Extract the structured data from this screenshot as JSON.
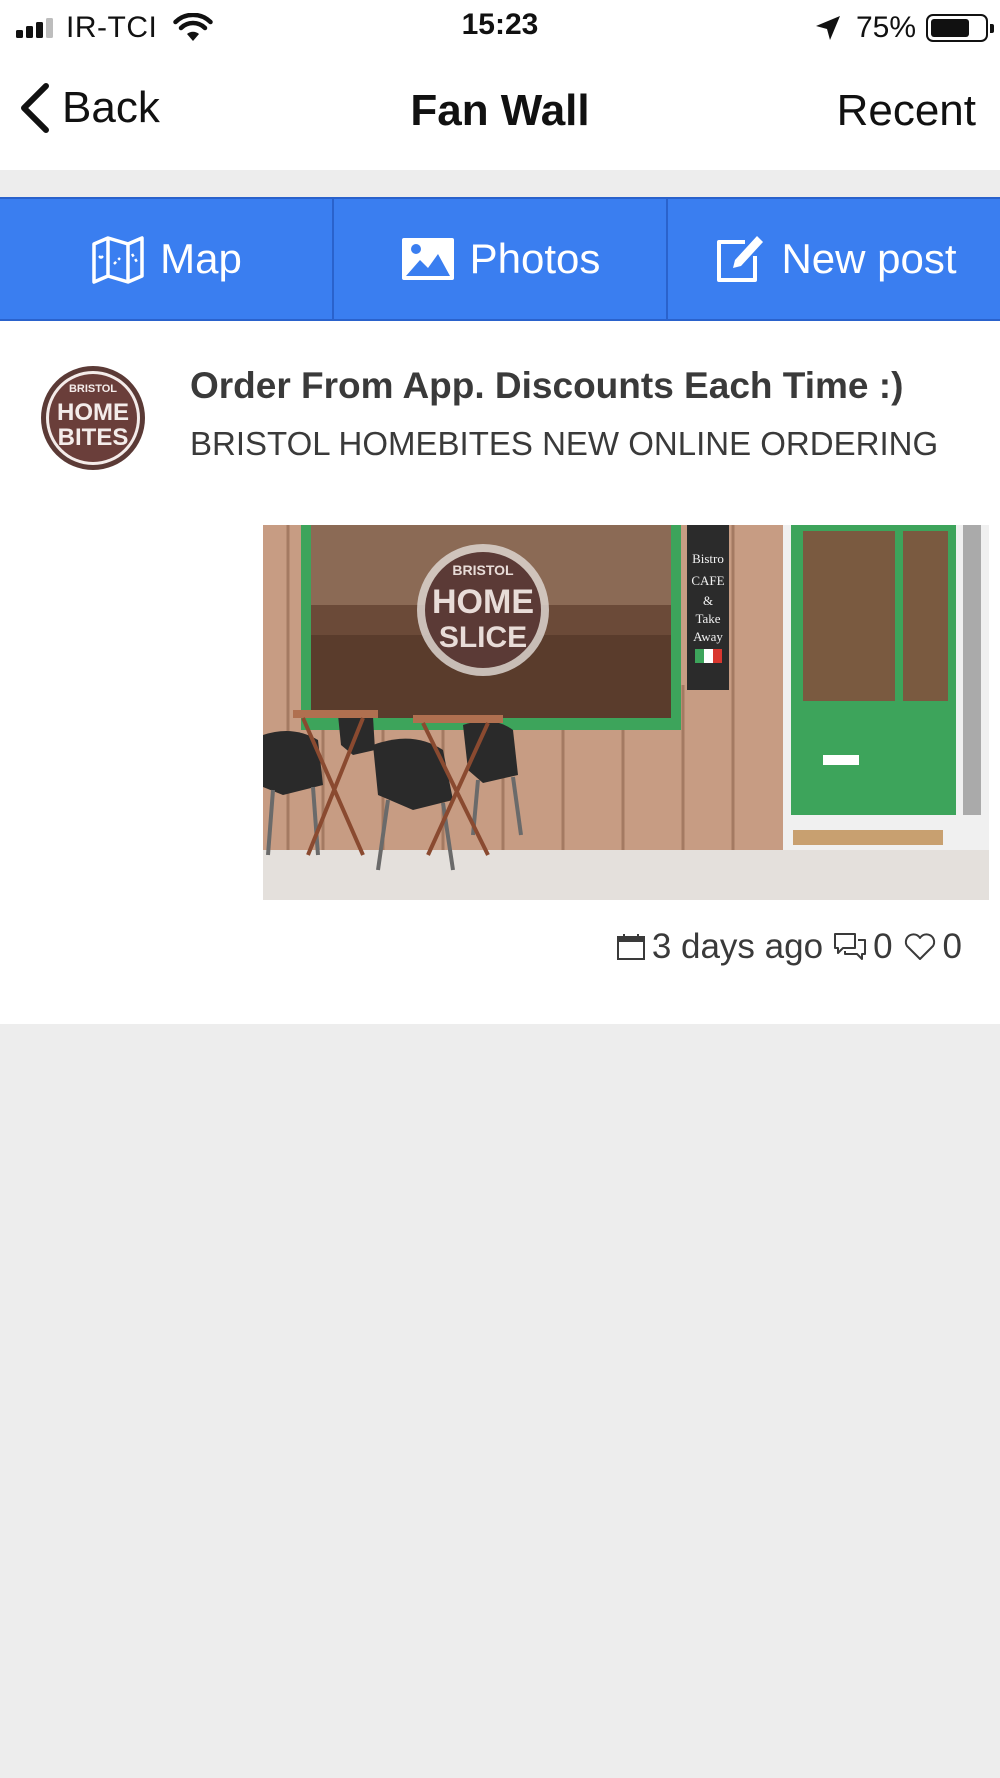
{
  "status_bar": {
    "carrier": "IR-TCI",
    "time": "15:23",
    "battery_percent_label": "75%",
    "battery_level": 0.75
  },
  "nav": {
    "back_label": "Back",
    "title": "Fan Wall",
    "right_label": "Recent"
  },
  "actions": [
    {
      "label": "Map",
      "icon": "map-icon"
    },
    {
      "label": "Photos",
      "icon": "photos-icon"
    },
    {
      "label": "New post",
      "icon": "edit-icon"
    }
  ],
  "post": {
    "title": "Order From App. Discounts Each Time :)",
    "snippet": "BRISTOL HOMEBITES NEW ONLINE ORDERING",
    "avatar_text": {
      "top": "BRISTOL",
      "line1": "HOME",
      "line2": "BITES"
    },
    "image_text": {
      "sign_line1": "HOME",
      "sign_line2": "SLICE",
      "sign_top": "BRISTOL",
      "board": [
        "Bistro",
        "CAFE",
        "&",
        "Take",
        "Away"
      ]
    },
    "time_ago": "3 days ago",
    "comments": "0",
    "likes": "0"
  },
  "colors": {
    "accent": "#3a7ef0",
    "background": "#ededed",
    "door_green": "#3da45b"
  }
}
